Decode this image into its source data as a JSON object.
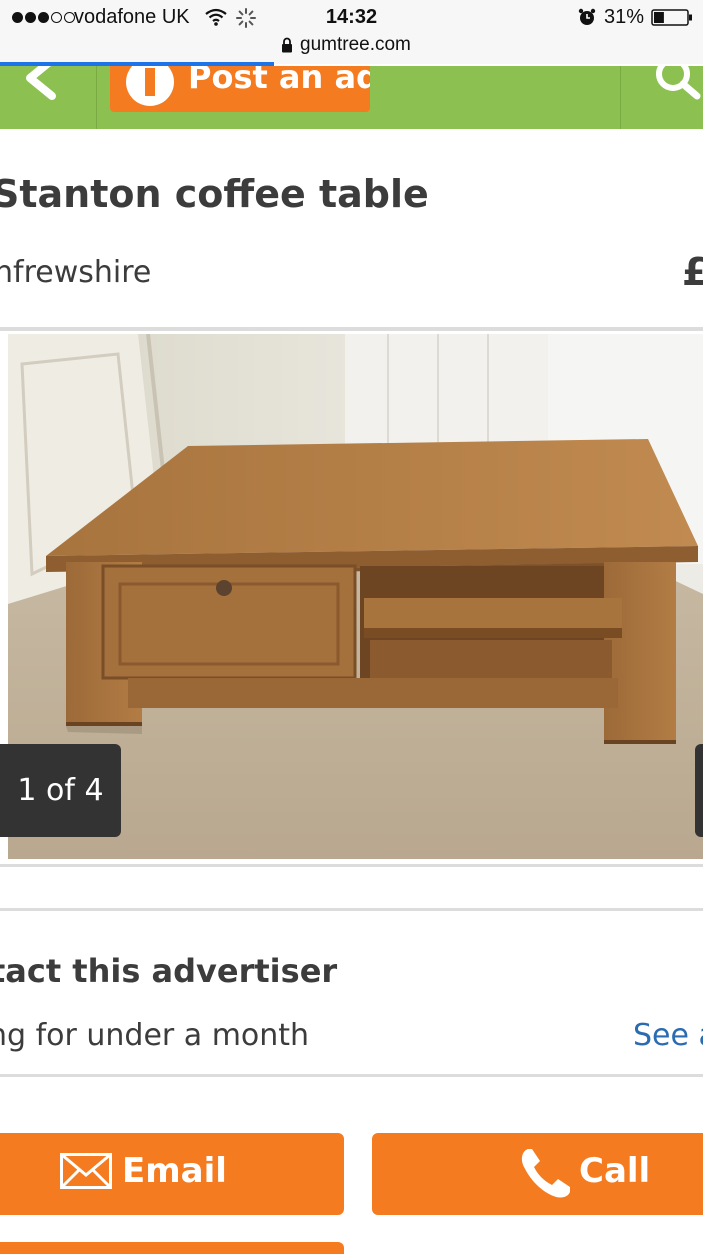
{
  "status_bar": {
    "carrier": "vodafone UK",
    "time": "14:32",
    "battery_percent": "31%",
    "battery_level": 0.31,
    "url": "gumtree.com",
    "page_load_progress": 0.39,
    "icons": [
      "signal-dots",
      "wifi-icon",
      "activity-icon",
      "alarm-icon",
      "battery-icon",
      "lock-icon"
    ]
  },
  "header": {
    "background": "#8cc152",
    "post_ad_label": "Post an ad",
    "post_ad_color": "#f47b20",
    "icons": [
      "back-arrow-icon",
      "plus-icon",
      "search-icon"
    ]
  },
  "listing": {
    "title": "Stanton coffee table",
    "location": "nfrewshire",
    "price": "£",
    "gallery_counter": "1 of 4"
  },
  "contact": {
    "heading": "tact this advertiser",
    "posting_duration": "ng for under a month",
    "see_all_link": "See a",
    "email_label": "Email",
    "call_label": "Call",
    "button_color": "#f47b20",
    "link_color": "#2b6cb0"
  }
}
